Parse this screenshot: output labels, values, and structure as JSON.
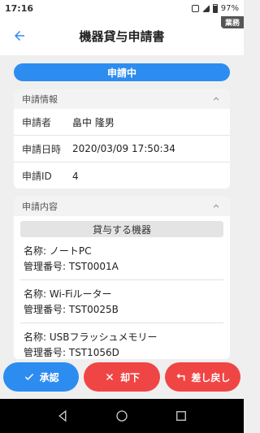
{
  "statusbar": {
    "time": "17:16",
    "battery": "97%"
  },
  "appbar": {
    "title": "機器貸与申請書",
    "badge": "業務"
  },
  "status": {
    "label": "申請中"
  },
  "info_card": {
    "header": "申請情報",
    "rows": [
      {
        "key": "申請者",
        "value": "畠中 隆男"
      },
      {
        "key": "申請日時",
        "value": "2020/03/09 17:50:34"
      },
      {
        "key": "申請ID",
        "value": "4"
      }
    ]
  },
  "content_card": {
    "header": "申請内容",
    "device_header": "貸与する機器",
    "devices": [
      {
        "name": "名称: ノートPC",
        "number": "管理番号: TST0001A"
      },
      {
        "name": "名称: Wi-Fiルーター",
        "number": "管理番号: TST0025B"
      },
      {
        "name": "名称: USBフラッシュメモリー",
        "number": "管理番号: TST1056D"
      }
    ]
  },
  "actions": {
    "approve": "承認",
    "reject": "却下",
    "return": "差し戻し"
  },
  "colors": {
    "accent": "#2d8cf0",
    "danger": "#f04545"
  }
}
